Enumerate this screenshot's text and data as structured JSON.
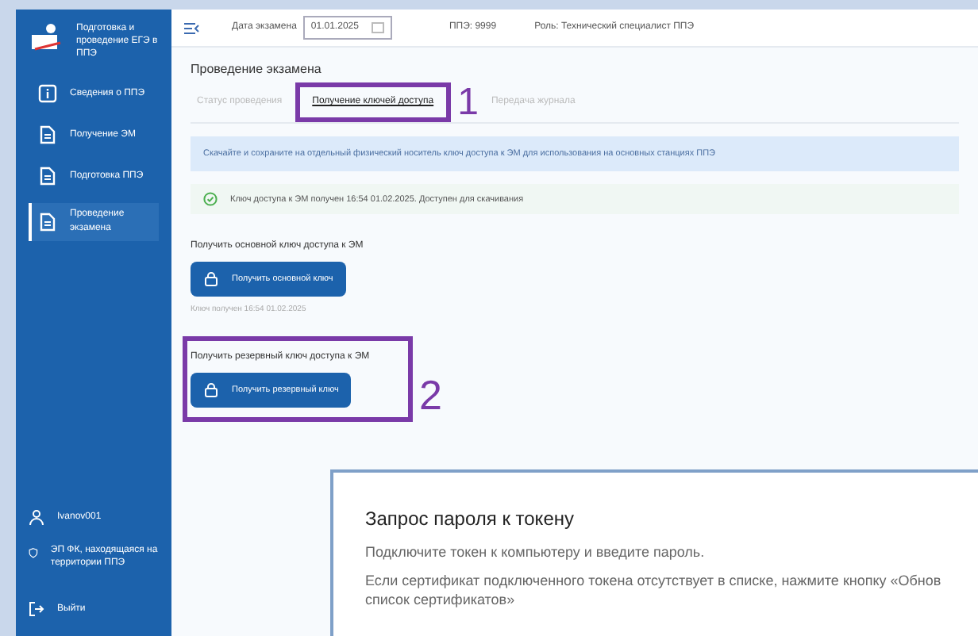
{
  "sidebar": {
    "logo_text": "Подготовка и проведение ЕГЭ в ППЭ",
    "items": [
      {
        "label": "Сведения о ППЭ",
        "kind": "info",
        "selected": false
      },
      {
        "label": "Получение ЭМ",
        "kind": "doc",
        "selected": false
      },
      {
        "label": "Подготовка ППЭ",
        "kind": "doc",
        "selected": false
      },
      {
        "label": "Проведение экзамена",
        "kind": "doc",
        "selected": true
      }
    ],
    "user": "Ivanov001",
    "org": "ЭП ФК, находящаяся на территории ППЭ",
    "logout": "Выйти"
  },
  "header": {
    "date_label": "Дата экзамена",
    "date_value": "01.01.2025",
    "ppe": "ППЭ: 9999",
    "role": "Роль: Технический специалист ППЭ"
  },
  "page": {
    "title": "Проведение экзамена",
    "tabs": [
      {
        "label": "Статус проведения",
        "selected": false
      },
      {
        "label": "Получение ключей доступа",
        "selected": true
      },
      {
        "label": "Передача журнала",
        "selected": false
      }
    ],
    "info": "Скачайте и сохраните на отдельный физический носитель ключ доступа к ЭМ для использования на основных станциях ППЭ",
    "success": "Ключ доступа к ЭМ получен 16:54 01.02.2025. Доступен для скачивания",
    "sections": [
      {
        "label": "Получить основной ключ доступа к ЭМ",
        "button": "Получить основной ключ",
        "note": "Ключ получен 16:54 01.02.2025"
      },
      {
        "label": "Получить резервный ключ доступа к ЭМ",
        "button": "Получить резервный ключ"
      }
    ]
  },
  "annotations": [
    "1",
    "2"
  ],
  "dialog": {
    "title": "Запрос пароля к токену",
    "lines": [
      "Подключите токен к компьютеру и введите пароль.",
      "Если сертификат подключенного токена отсутствует в списке, нажмите кнопку «Обнов список сертификатов»"
    ]
  }
}
